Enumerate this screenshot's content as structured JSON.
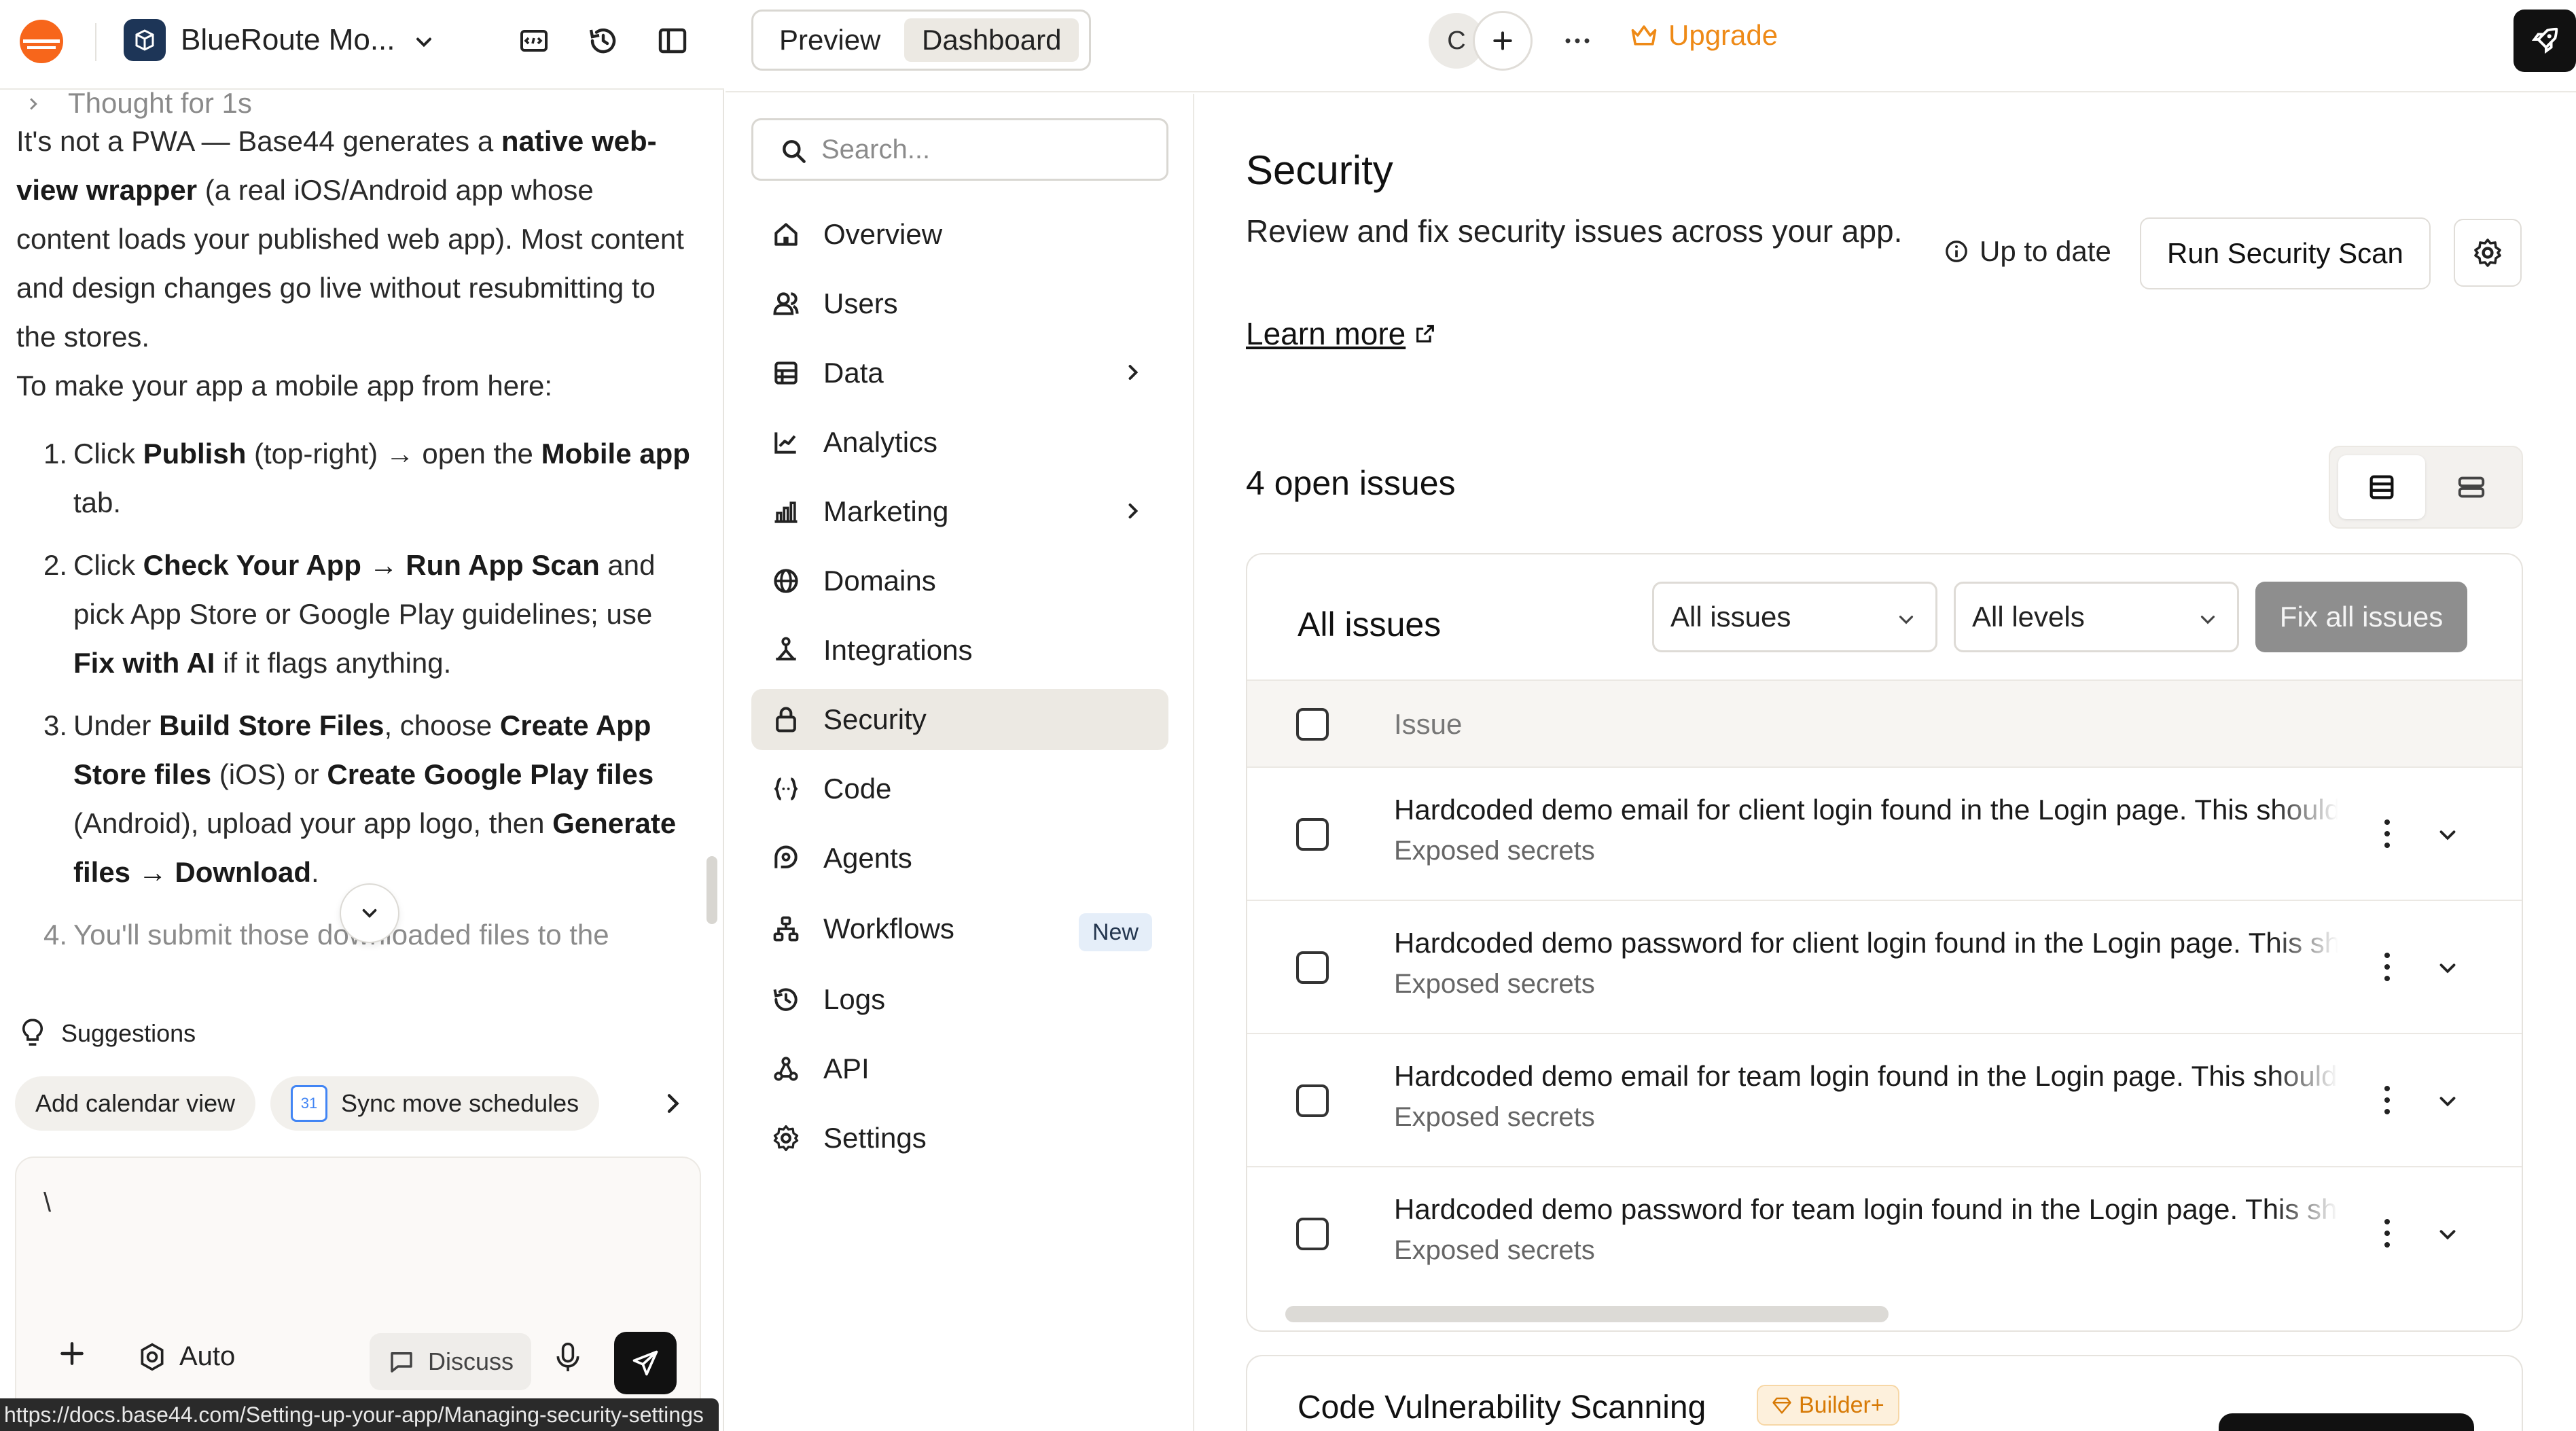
{
  "app": {
    "name": "BlueRoute Mo...",
    "status_url": "https://docs.base44.com/Setting-up-your-app/Managing-security-settings"
  },
  "chat": {
    "thought": "Thought for 1s",
    "para1": {
      "t1": "It's not a PWA — Base44 generates a ",
      "b1": "native web-view wrapper",
      "t2": " (a real iOS/Android app whose content loads your published web app). Most content and design changes go live without resubmitting to the stores."
    },
    "para2": "To make your app a mobile app from here:",
    "steps": [
      {
        "num": "1.",
        "t1": "Click ",
        "b1": "Publish",
        "t2": " (top-right) → open the ",
        "b2": "Mobile app",
        "t3": " tab."
      },
      {
        "num": "2.",
        "t1": "Click ",
        "b1": "Check Your App → Run App Scan",
        "t2": " and pick App Store or Google Play guidelines; use ",
        "b2": "Fix with AI",
        "t3": " if it flags anything."
      },
      {
        "num": "3.",
        "t1": "Under ",
        "b1": "Build Store Files",
        "t2": ", choose ",
        "b2": "Create App Store files",
        "t3": " (iOS) or ",
        "b3": "Create Google Play files",
        "t4": " (Android), upload your app logo, then ",
        "b4": "Generate files → Download",
        "t5": "."
      },
      {
        "num": "4.",
        "t1": "You'll submit those downloaded files to the"
      }
    ]
  },
  "suggestions": {
    "header": "Suggestions",
    "chips": [
      "Add calendar view",
      "Sync move schedules"
    ],
    "calendar_badge": "31"
  },
  "composer": {
    "text": "\\",
    "mode": "Auto",
    "discuss": "Discuss"
  },
  "topbar": {
    "preview": "Preview",
    "dashboard": "Dashboard",
    "avatar_initial": "C",
    "upgrade": "Upgrade"
  },
  "nav": {
    "search_placeholder": "Search...",
    "items": [
      {
        "label": "Overview"
      },
      {
        "label": "Users"
      },
      {
        "label": "Data"
      },
      {
        "label": "Analytics"
      },
      {
        "label": "Marketing"
      },
      {
        "label": "Domains"
      },
      {
        "label": "Integrations"
      },
      {
        "label": "Security"
      },
      {
        "label": "Code"
      },
      {
        "label": "Agents"
      },
      {
        "label": "Workflows",
        "badge": "New"
      },
      {
        "label": "Logs"
      },
      {
        "label": "API"
      },
      {
        "label": "Settings"
      }
    ]
  },
  "security": {
    "title": "Security",
    "description": "Review and fix security issues across your app.",
    "learn_more": "Learn more",
    "status": "Up to date",
    "run_scan": "Run Security Scan",
    "open_issues": "4 open issues",
    "card_title": "All issues",
    "filter_type": "All issues",
    "filter_level": "All levels",
    "fix_all": "Fix all issues",
    "column_issue": "Issue",
    "issues": [
      {
        "title": "Hardcoded demo email for client login found in the Login page. This should",
        "category": "Exposed secrets"
      },
      {
        "title": "Hardcoded demo password for client login found in the Login page. This should",
        "category": "Exposed secrets"
      },
      {
        "title": "Hardcoded demo email for team login found in the Login page. This should",
        "category": "Exposed secrets"
      },
      {
        "title": "Hardcoded demo password for team login found in the Login page. This should",
        "category": "Exposed secrets"
      }
    ],
    "vuln_title": "Code Vulnerability Scanning",
    "vuln_badge": "Builder+"
  },
  "colors": {
    "accent_orange": "#ee8a17",
    "active_nav_bg": "#ece9e3",
    "fix_all_bg": "#8e8e8e",
    "new_badge_bg": "#e5eef9"
  }
}
